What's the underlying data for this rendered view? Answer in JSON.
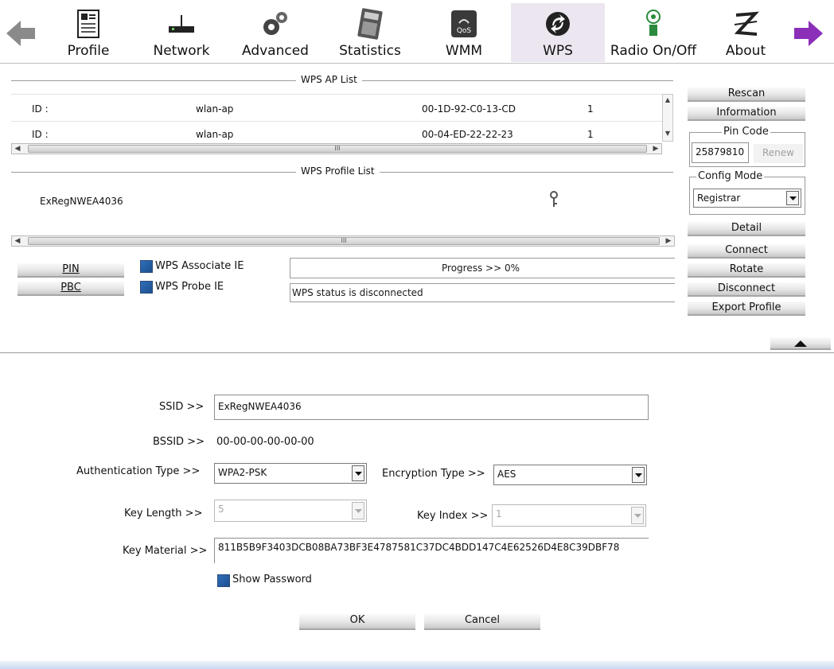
{
  "toolbar": {
    "items": [
      {
        "label": "Profile",
        "icon": "profile-icon"
      },
      {
        "label": "Network",
        "icon": "network-icon"
      },
      {
        "label": "Advanced",
        "icon": "advanced-gears-icon"
      },
      {
        "label": "Statistics",
        "icon": "statistics-calculator-icon"
      },
      {
        "label": "WMM",
        "icon": "wmm-qos-icon"
      },
      {
        "label": "WPS",
        "icon": "wps-icon",
        "active": true
      },
      {
        "label": "Radio On/Off",
        "icon": "radio-icon"
      },
      {
        "label": "About",
        "icon": "about-icon"
      }
    ],
    "back_icon": "back-arrow-icon",
    "forward_icon": "forward-arrow-icon"
  },
  "ap_list": {
    "title": "WPS AP List",
    "rows": [
      {
        "id_label": "ID :",
        "ssid": "wlan-ap",
        "mac": "00-1D-92-C0-13-CD",
        "channel": "1"
      },
      {
        "id_label": "ID :",
        "ssid": "wlan-ap",
        "mac": "00-04-ED-22-22-23",
        "channel": "1"
      }
    ]
  },
  "profile_list": {
    "title": "WPS Profile List",
    "rows": [
      {
        "name": "ExRegNWEA4036",
        "icon": "key-icon"
      }
    ]
  },
  "scroll_thumb_glyph": "III",
  "buttons": {
    "pin": "PIN",
    "pbc": "PBC",
    "rescan": "Rescan",
    "information": "Information",
    "renew": "Renew",
    "detail": "Detail",
    "connect": "Connect",
    "rotate": "Rotate",
    "disconnect": "Disconnect",
    "export_profile": "Export Profile",
    "ok": "OK",
    "cancel": "Cancel"
  },
  "checks": {
    "wps_associate_ie": "WPS Associate IE",
    "wps_probe_ie": "WPS Probe IE",
    "show_password": "Show Password"
  },
  "progress": {
    "text": "Progress >> 0%",
    "value_percent": 0
  },
  "status_text": "WPS status is disconnected",
  "pin_code": {
    "legend": "Pin Code",
    "value": "25879810"
  },
  "config_mode": {
    "legend": "Config Mode",
    "value": "Registrar"
  },
  "detail": {
    "ssid_label": "SSID >>",
    "ssid_value": "ExRegNWEA4036",
    "bssid_label": "BSSID >>",
    "bssid_value": "00-00-00-00-00-00",
    "auth_label": "Authentication Type >>",
    "auth_value": "WPA2-PSK",
    "enc_label": "Encryption Type >>",
    "enc_value": "AES",
    "key_length_label": "Key Length >>",
    "key_length_value": "5",
    "key_index_label": "Key Index >>",
    "key_index_value": "1",
    "key_material_label": "Key Material >>",
    "key_material_value": "811B5B9F3403DCB08BA73BF3E4787581C37DC4BDD147C4E62526D4E8C39DBF78"
  },
  "colors": {
    "active_tab_bg": "#ece6f0",
    "checkbox_blue": "#1c4f8f",
    "forward_arrow": "#8b2fb8",
    "back_arrow": "#8a8a8a"
  }
}
